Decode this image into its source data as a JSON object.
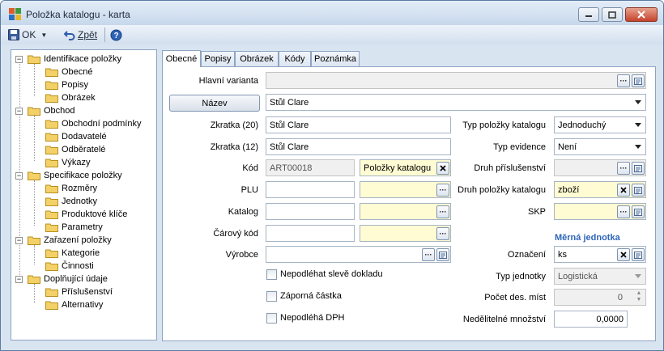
{
  "window": {
    "title": "Položka katalogu - karta"
  },
  "toolbar": {
    "ok_label": "OK",
    "back_label": "Zpět"
  },
  "tree": [
    {
      "label": "Identifikace položky",
      "level": 0
    },
    {
      "label": "Obecné",
      "level": 1
    },
    {
      "label": "Popisy",
      "level": 1
    },
    {
      "label": "Obrázek",
      "level": 1
    },
    {
      "label": "Obchod",
      "level": 0
    },
    {
      "label": "Obchodní podmínky",
      "level": 1
    },
    {
      "label": "Dodavatelé",
      "level": 1
    },
    {
      "label": "Odběratelé",
      "level": 1
    },
    {
      "label": "Výkazy",
      "level": 1
    },
    {
      "label": "Specifikace položky",
      "level": 0
    },
    {
      "label": "Rozměry",
      "level": 1
    },
    {
      "label": "Jednotky",
      "level": 1
    },
    {
      "label": "Produktové klíče",
      "level": 1
    },
    {
      "label": "Parametry",
      "level": 1
    },
    {
      "label": "Zařazení položky",
      "level": 0
    },
    {
      "label": "Kategorie",
      "level": 1
    },
    {
      "label": "Činnosti",
      "level": 1
    },
    {
      "label": "Doplňující údaje",
      "level": 0
    },
    {
      "label": "Příslušenství",
      "level": 1
    },
    {
      "label": "Alternativy",
      "level": 1
    }
  ],
  "tabs": [
    "Obecné",
    "Popisy",
    "Obrázek",
    "Kódy",
    "Poznámka"
  ],
  "form": {
    "hlavni_varianta": {
      "label": "Hlavní varianta",
      "value": ""
    },
    "nazev": {
      "button": "Název",
      "value": "Stůl Clare"
    },
    "zkratka20": {
      "label": "Zkratka (20)",
      "value": "Stůl Clare"
    },
    "zkratka12": {
      "label": "Zkratka (12)",
      "value": "Stůl Clare"
    },
    "kod": {
      "label": "Kód",
      "value": "ART00018",
      "catalog": "Položky katalogu"
    },
    "plu": {
      "label": "PLU",
      "value": ""
    },
    "katalog": {
      "label": "Katalog",
      "value": ""
    },
    "carovy_kod": {
      "label": "Čárový kód",
      "value": ""
    },
    "vyrobce": {
      "label": "Výrobce",
      "value": ""
    },
    "checkboxes": [
      {
        "label": "Nepodléhat slevě dokladu",
        "checked": false
      },
      {
        "label": "Záporná částka",
        "checked": false
      },
      {
        "label": "Nepodléhá DPH",
        "checked": false
      }
    ],
    "typ_polozky": {
      "label": "Typ položky katalogu",
      "value": "Jednoduchý"
    },
    "typ_evidence": {
      "label": "Typ evidence",
      "value": "Není"
    },
    "druh_prislusenstvi": {
      "label": "Druh příslušenství",
      "value": ""
    },
    "druh_polozky": {
      "label": "Druh položky katalogu",
      "value": "zboží"
    },
    "skp": {
      "label": "SKP",
      "value": ""
    },
    "merna_jednotka": {
      "heading": "Měrná jednotka"
    },
    "oznaceni": {
      "label": "Označení",
      "value": "ks"
    },
    "typ_jednotky": {
      "label": "Typ jednotky",
      "value": "Logistická"
    },
    "pocet_des_mist": {
      "label": "Počet des. míst",
      "value": "0"
    },
    "nedelitelne": {
      "label": "Nedělitelné množství",
      "value": "0,0000"
    }
  }
}
